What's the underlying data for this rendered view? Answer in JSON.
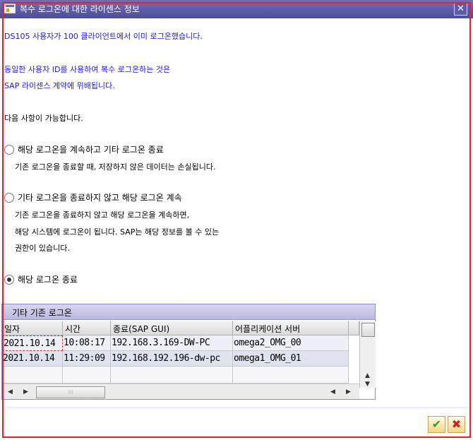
{
  "window": {
    "title": "복수 로그온에 대한 라이센스 정보",
    "close_glyph": "✕"
  },
  "message": {
    "line1": "DS105 사용자가 100 클라이언트에서 이미 로그온했습니다.",
    "line2": "동일한 사용자 ID를 사용하여 복수 로그온하는 것은",
    "line3": "SAP 라이센스 계약에 위배됩니다.",
    "line4": "다음 사항이 가능합니다."
  },
  "options": [
    {
      "label": "해당 로그온을 계속하고 기타 로그온 종료",
      "desc": [
        "기존 로그온을 종료할 때, 저장하지 않은 데이터는 손실됩니다."
      ],
      "checked": false
    },
    {
      "label": "기타 로그온을 종료하지 않고 해당 로그온 계속",
      "desc": [
        "기존 로그온을 종료하지 않고 해당 로그온을 계속하면,",
        "해당 시스템에 로그온이 됩니다. SAP는 해당 정보를 볼 수 있는",
        "권한이 있습니다."
      ],
      "checked": false
    },
    {
      "label": "해당 로그온 종료",
      "desc": [],
      "checked": true
    }
  ],
  "table": {
    "title": "기타 기존 로그온",
    "columns": [
      "일자",
      "시간",
      "종료(SAP GUI)",
      "어플리케이션 서버"
    ],
    "rows": [
      [
        "2021.10.14",
        "10:08:17",
        "192.168.3.169-DW-PC",
        "omega2_OMG_00"
      ],
      [
        "2021.10.14",
        "11:29:09",
        "192.168.192.196-dw-pc",
        "omega1_OMG_01"
      ]
    ]
  },
  "icons": {
    "title_icon": "sap-window-icon",
    "ok": "checkmark-icon",
    "cancel": "cancel-x-icon"
  },
  "buttons": {
    "ok_glyph": "✔",
    "cancel_glyph": "✖"
  },
  "colors": {
    "titlebar": "#5a5aa6",
    "message_text": "#1a1adc",
    "highlight_frame": "#e8202a"
  }
}
